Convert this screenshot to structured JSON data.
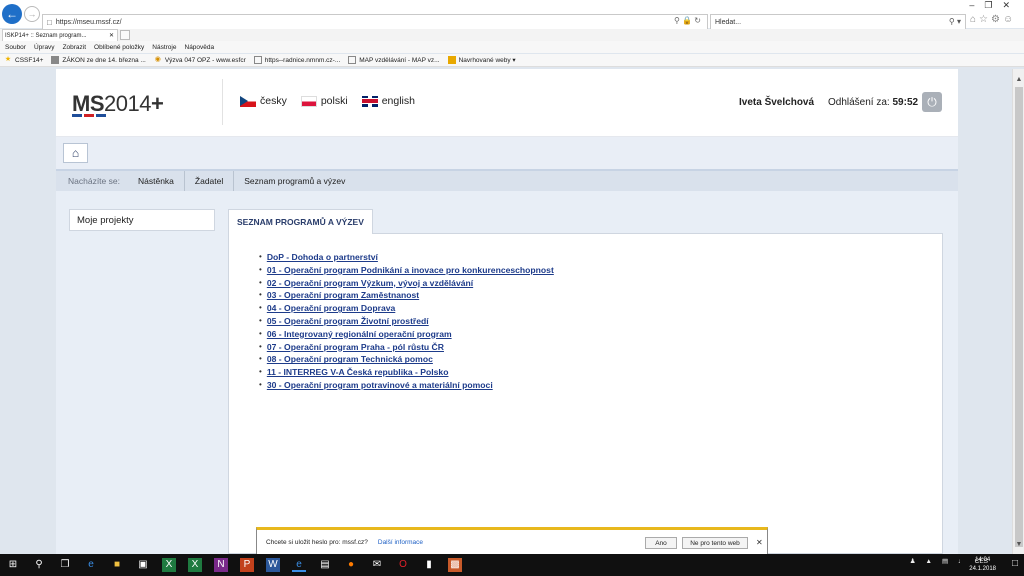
{
  "browser": {
    "url": "https://mseu.mssf.cz/",
    "search_placeholder": "Hledat...",
    "tab_title": "ISKP14+ :: Seznam program...",
    "menu": [
      "Soubor",
      "Úpravy",
      "Zobrazit",
      "Oblíbené položky",
      "Nástroje",
      "Nápověda"
    ],
    "favorites": [
      {
        "label": "CSSF14+",
        "icon": "star-icon",
        "color": "#f0b400"
      },
      {
        "label": "ZÁKON ze dne 14. března ...",
        "icon": "page-icon",
        "color": "#888888"
      },
      {
        "label": "Výzva 047 OPZ - www.esfcr",
        "icon": "globe-icon",
        "color": "#d68f00"
      },
      {
        "label": "https--radnice.nmnm.cz-...",
        "icon": "page-icon",
        "color": "#888888"
      },
      {
        "label": "MAP vzdělávání - MAP vz...",
        "icon": "page-icon",
        "color": "#888888"
      },
      {
        "label": "Navrhované weby ▾",
        "icon": "suggested-icon",
        "color": "#e8a800"
      }
    ]
  },
  "header": {
    "logo_text": "MS2014+",
    "logo_bold": "MS",
    "logo_light": "2014",
    "logo_plus": "+",
    "logo_colors": [
      "#1f4e9a",
      "#d02024",
      "#1f4e9a"
    ],
    "languages": [
      "česky",
      "polski",
      "english"
    ],
    "user_name": "Iveta Švelchová",
    "logout_label": "Odhlášení za:",
    "logout_time": "59:52"
  },
  "breadcrumb": {
    "lead": "Nacházíte se:",
    "items": [
      "Nástěnka",
      "Žadatel",
      "Seznam programů a výzev"
    ]
  },
  "sidebar": {
    "item": "Moje projekty"
  },
  "panel": {
    "title": "SEZNAM PROGRAMŮ A VÝZEV",
    "programs": [
      "DoP - Dohoda o partnerství",
      "01 - Operační program Podnikání a inovace pro konkurenceschopnost",
      "02 - Operační program Výzkum, vývoj a vzdělávání",
      "03 - Operační program Zaměstnanost",
      "04 - Operační program Doprava",
      "05 - Operační program Životní prostředí",
      "06 - Integrovaný regionální operační program",
      "07 - Operační program Praha - pól růstu ČR",
      "08 - Operační program Technická pomoc",
      "11 - INTERREG V-A Česká republika - Polsko",
      "30 - Operační program potravinové a materiální pomoci"
    ]
  },
  "notification": {
    "message": "Chcete si uložit heslo pro: mssf.cz?",
    "more": "Další informace",
    "yes": "Ano",
    "no": "Ne pro tento web"
  },
  "taskbar": {
    "lang": "CES",
    "time": "14:04",
    "date": "24.1.2018"
  },
  "colors": {
    "accent": "#1d3b8a",
    "notification_border": "#e8b81c"
  }
}
